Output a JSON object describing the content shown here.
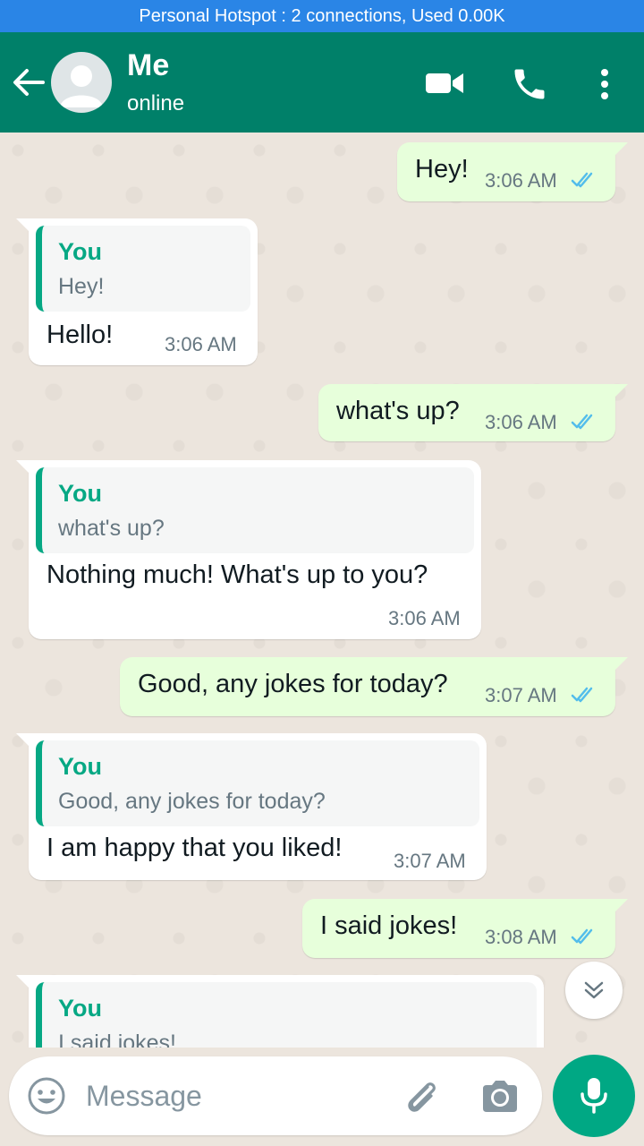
{
  "status_bar": {
    "hotspot_text": "Personal Hotspot : 2 connections, Used 0.00K",
    "color": "#2a85e6"
  },
  "header": {
    "name": "Me",
    "status": "online",
    "color": "#008069"
  },
  "messages": [
    {
      "direction": "out",
      "text": "Hey!",
      "time": "3:06 AM",
      "read": true
    },
    {
      "direction": "in",
      "quote_author": "You",
      "quote_text": "Hey!",
      "text": "Hello!",
      "time": "3:06 AM"
    },
    {
      "direction": "out",
      "text": "what's up?",
      "time": "3:06 AM",
      "read": true
    },
    {
      "direction": "in",
      "quote_author": "You",
      "quote_text": "what's up?",
      "text": "Nothing much! What's up to you?",
      "time": "3:06 AM"
    },
    {
      "direction": "out",
      "text": "Good, any jokes for today?",
      "time": "3:07 AM",
      "read": true
    },
    {
      "direction": "in",
      "quote_author": "You",
      "quote_text": "Good, any jokes for today?",
      "text": "I am happy that you liked!",
      "time": "3:07 AM"
    },
    {
      "direction": "out",
      "text": "I said jokes!",
      "time": "3:08 AM",
      "read": true
    },
    {
      "direction": "in",
      "quote_author": "You",
      "quote_text": "I said jokes!"
    }
  ],
  "composer": {
    "placeholder": "Message"
  },
  "colors": {
    "accent": "#00a884",
    "outgoing_bubble": "#e7ffdb",
    "read_ticks": "#53bdeb",
    "quote_bar": "#06a884"
  },
  "icons": [
    "back-arrow-icon",
    "avatar-icon",
    "video-call-icon",
    "phone-icon",
    "more-vert-icon",
    "double-check-icon",
    "chevron-double-down-icon",
    "emoji-icon",
    "attachment-icon",
    "camera-icon",
    "mic-icon"
  ]
}
